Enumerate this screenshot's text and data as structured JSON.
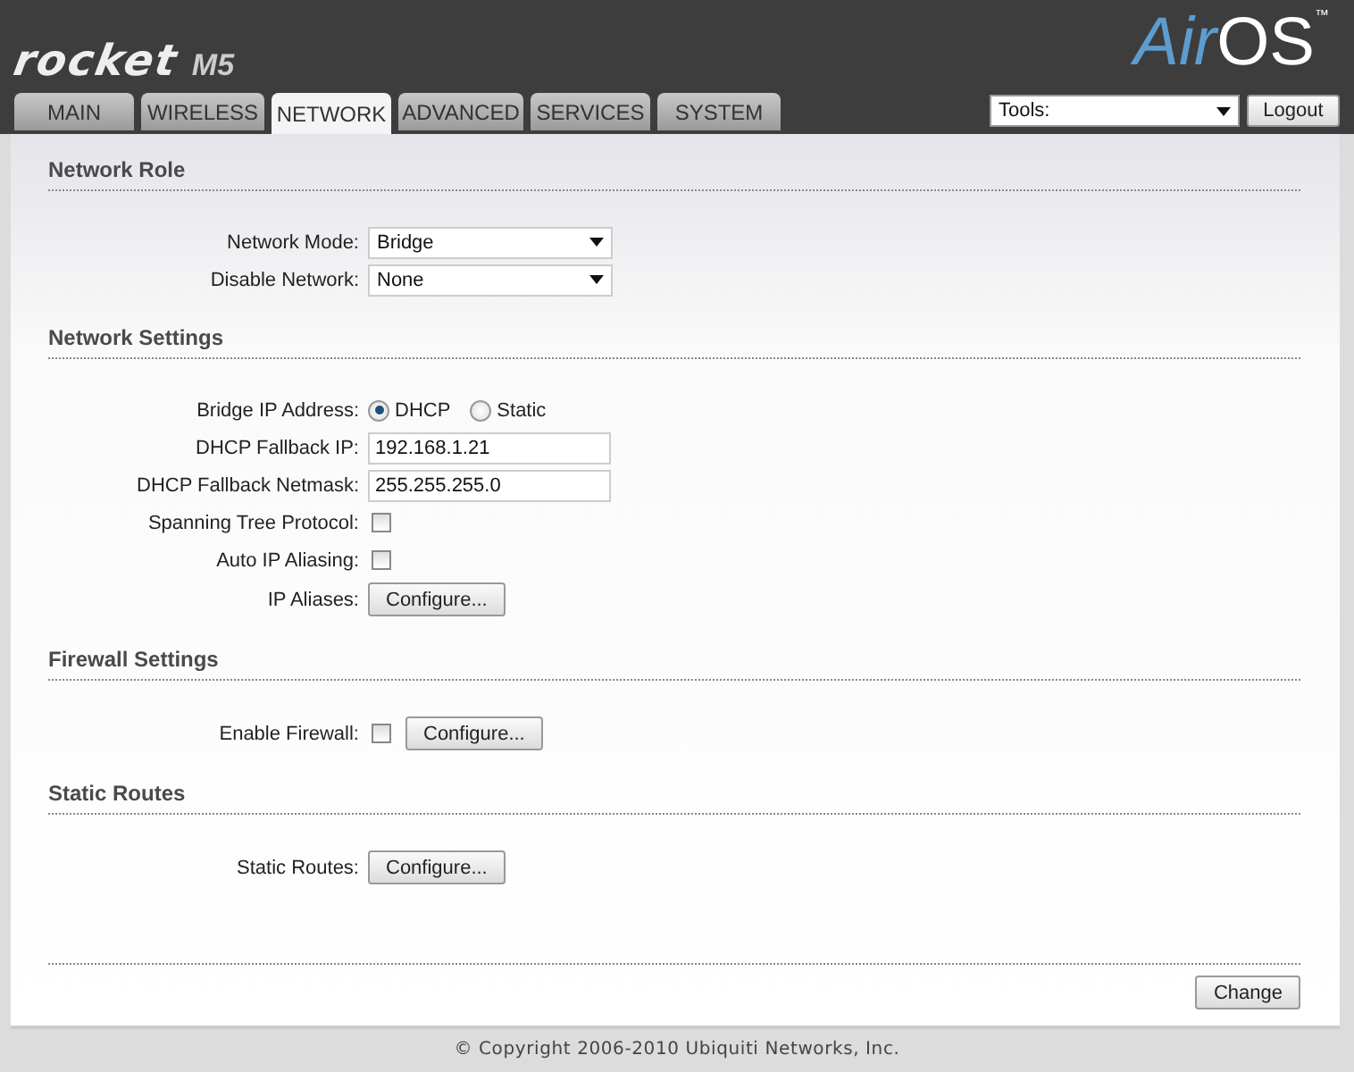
{
  "header": {
    "product": "rocket",
    "model": "M5",
    "brand_a": "Air",
    "brand_b": "OS",
    "trademark": "™"
  },
  "tabs": [
    {
      "label": "MAIN",
      "selected": false
    },
    {
      "label": "WIRELESS",
      "selected": false
    },
    {
      "label": "NETWORK",
      "selected": true
    },
    {
      "label": "ADVANCED",
      "selected": false
    },
    {
      "label": "SERVICES",
      "selected": false
    },
    {
      "label": "SYSTEM",
      "selected": false
    }
  ],
  "tools": {
    "value": "Tools:"
  },
  "logout": "Logout",
  "sections": [
    {
      "title": "Network Role",
      "rows": [
        {
          "kind": "select",
          "label": "Network Mode:",
          "value": "Bridge"
        },
        {
          "kind": "select",
          "label": "Disable Network:",
          "value": "None"
        }
      ]
    },
    {
      "title": "Network Settings",
      "rows": [
        {
          "kind": "radio",
          "label": "Bridge IP Address:",
          "options": [
            {
              "label": "DHCP",
              "selected": true
            },
            {
              "label": "Static",
              "selected": false
            }
          ]
        },
        {
          "kind": "text",
          "label": "DHCP Fallback IP:",
          "value": "192.168.1.21"
        },
        {
          "kind": "text",
          "label": "DHCP Fallback Netmask:",
          "value": "255.255.255.0"
        },
        {
          "kind": "checkbox",
          "label": "Spanning Tree Protocol:",
          "checked": false
        },
        {
          "kind": "checkbox",
          "label": "Auto IP Aliasing:",
          "checked": false
        },
        {
          "kind": "button",
          "label": "IP Aliases:",
          "button": "Configure..."
        }
      ]
    },
    {
      "title": "Firewall Settings",
      "rows": [
        {
          "kind": "checkbox",
          "label": "Enable Firewall:",
          "checked": false,
          "button": "Configure..."
        }
      ]
    },
    {
      "title": "Static Routes",
      "rows": [
        {
          "kind": "button",
          "label": "Static Routes:",
          "button": "Configure..."
        }
      ]
    }
  ],
  "change": "Change",
  "footer": "© Copyright 2006-2010 Ubiquiti Networks, Inc."
}
